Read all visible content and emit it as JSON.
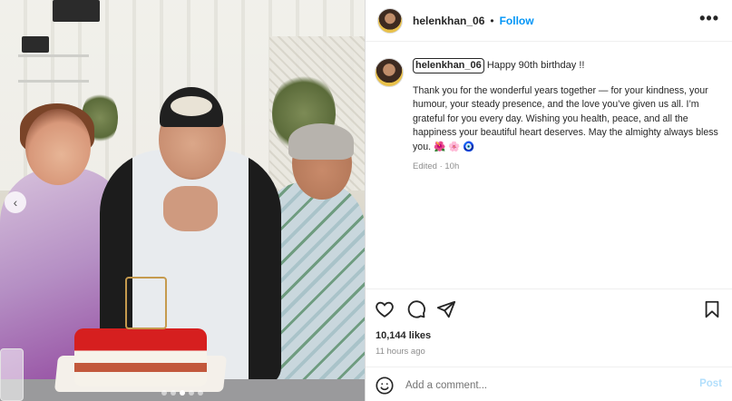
{
  "header": {
    "username": "helenkhan_06",
    "separator": "•",
    "follow_label": "Follow",
    "more_label": "•••"
  },
  "caption": {
    "username": "helenkhan_06",
    "first_line": " Happy 90th birthday !!",
    "body": "Thank you for the wonderful years together — for your kindness, your humour, your steady presence, and the love you’ve given us all. I’m grateful for you every day. Wishing you health, peace, and all the happiness your beautiful heart deserves. May the almighty always bless you. 🌺 🌸 🧿",
    "edited": "Edited · 10h"
  },
  "engagement": {
    "likes": "10,144 likes",
    "time_ago": "11 hours ago"
  },
  "comment": {
    "placeholder": "Add a comment...",
    "post_label": "Post"
  },
  "carousel": {
    "prev_arrow": "‹",
    "slide_count": 5,
    "active_slide": 3
  },
  "colors": {
    "accent": "#0095f6",
    "post_disabled": "#b2dffc",
    "secondary_text": "#8e8e8e"
  },
  "icons": {
    "like": "heart-icon",
    "comment": "comment-icon",
    "share": "share-icon",
    "save": "bookmark-icon",
    "emoji": "emoji-icon",
    "more": "more-options-icon"
  }
}
